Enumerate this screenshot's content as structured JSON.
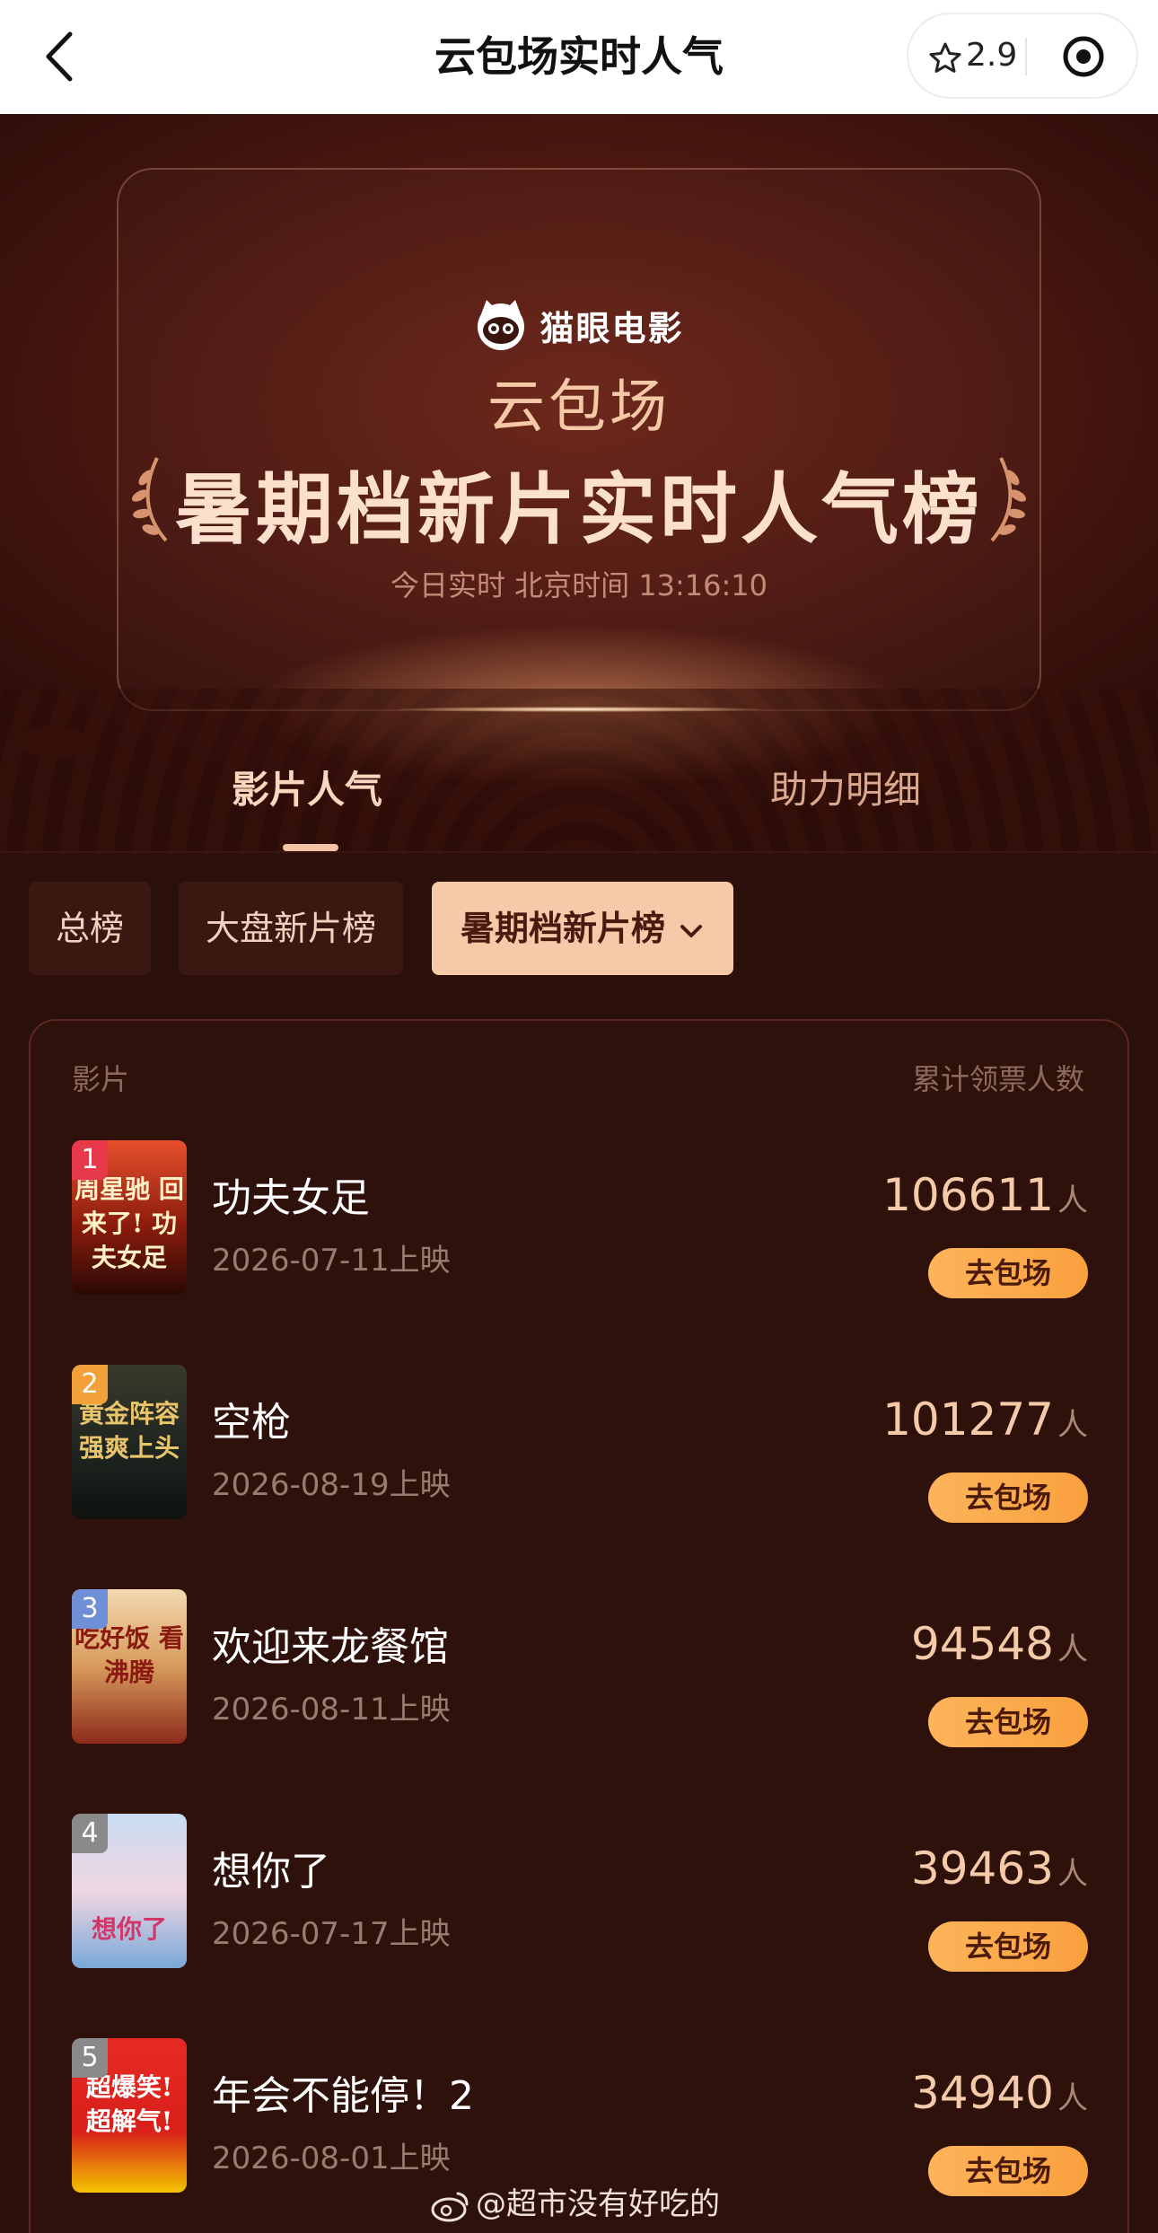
{
  "nav": {
    "title": "云包场实时人气",
    "rating": "2.9"
  },
  "hero": {
    "brand": "猫眼电影",
    "sub_title": "云包场",
    "main_title": "暑期档新片实时人气榜",
    "realtime": "今日实时 北京时间 13:16:10"
  },
  "tabs": [
    {
      "label": "影片人气",
      "active": true
    },
    {
      "label": "助力明细",
      "active": false
    }
  ],
  "filters": [
    {
      "label": "总榜",
      "active": false
    },
    {
      "label": "大盘新片榜",
      "active": false
    },
    {
      "label": "暑期档新片榜",
      "active": true
    }
  ],
  "table": {
    "col_movie": "影片",
    "col_count": "累计领票人数",
    "unit": "人",
    "button_label": "去包场",
    "rows": [
      {
        "rank": "1",
        "name": "功夫女足",
        "date": "2026-07-11上映",
        "count": "106611",
        "badge_color": "#e8394a",
        "poster_text": "周星驰 回来了! 功夫女足"
      },
      {
        "rank": "2",
        "name": "空枪",
        "date": "2026-08-19上映",
        "count": "101277",
        "badge_color": "#f2a03a",
        "poster_text": "黄金阵容 强爽上头"
      },
      {
        "rank": "3",
        "name": "欢迎来龙餐馆",
        "date": "2026-08-11上映",
        "count": "94548",
        "badge_color": "#6f8fd6",
        "poster_text": "吃好饭 看沸腾"
      },
      {
        "rank": "4",
        "name": "想你了",
        "date": "2026-07-17上映",
        "count": "39463",
        "badge_color": "#8a8a8a",
        "poster_text": "想你了"
      },
      {
        "rank": "5",
        "name": "年会不能停！2",
        "date": "2026-08-01上映",
        "count": "34940",
        "badge_color": "#8a8a8a",
        "poster_text": "超爆笑! 超解气!"
      }
    ]
  },
  "watermark": "@超市没有好吃的",
  "colors": {
    "accent": "#f6c9a8",
    "button": "#fdb45a",
    "background": "#2a0f0b"
  }
}
